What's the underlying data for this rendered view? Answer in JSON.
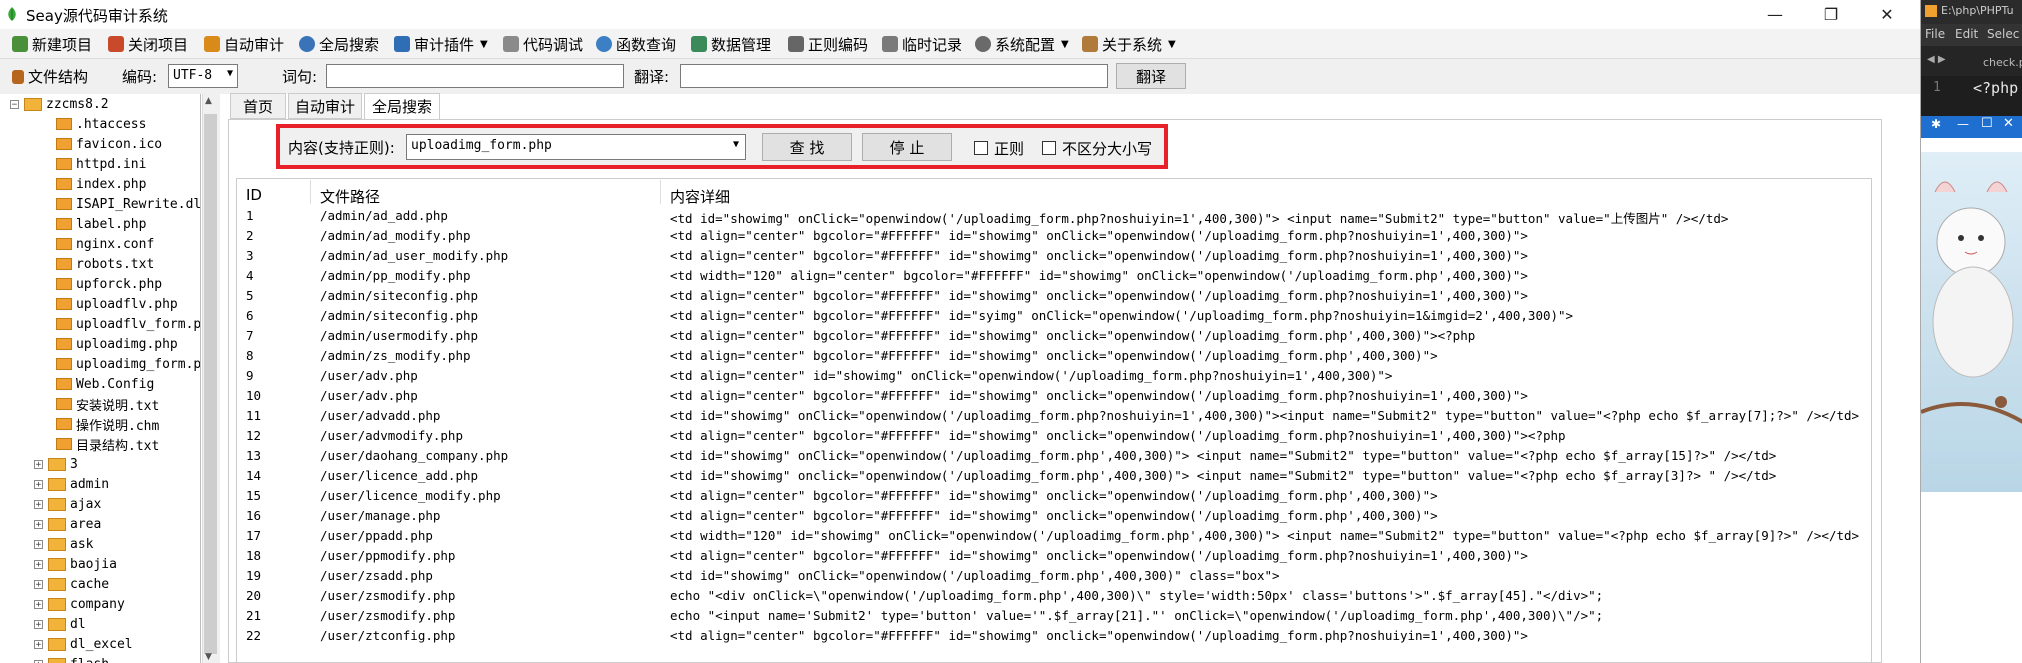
{
  "title": "Seay源代码审计系统",
  "toolbar": [
    {
      "label": "新建项目",
      "icon": "new-project-icon",
      "color": "#4a8f3a"
    },
    {
      "label": "关闭项目",
      "icon": "close-project-icon",
      "color": "#c84a2a"
    },
    {
      "label": "自动审计",
      "icon": "auto-audit-icon",
      "color": "#d98b1a"
    },
    {
      "label": "全局搜索",
      "icon": "global-search-icon",
      "color": "#3a73b8"
    },
    {
      "label": "审计插件",
      "icon": "plugin-icon",
      "color": "#2f6db5"
    },
    {
      "label": "代码调试",
      "icon": "debug-icon",
      "color": "#8a8a8a"
    },
    {
      "label": "函数查询",
      "icon": "function-search-icon",
      "color": "#3d7fc4"
    },
    {
      "label": "数据管理",
      "icon": "data-manage-icon",
      "color": "#3a8a5a"
    },
    {
      "label": "正则编码",
      "icon": "regex-encode-icon",
      "color": "#666666"
    },
    {
      "label": "临时记录",
      "icon": "temp-record-icon",
      "color": "#7a7a7a"
    },
    {
      "label": "系统配置",
      "icon": "settings-icon",
      "color": "#6a6a6a"
    },
    {
      "label": "关于系统",
      "icon": "about-icon",
      "color": "#b07a3a"
    }
  ],
  "toolbar2": {
    "structure_label": "文件结构",
    "encoding_label": "编码:",
    "encoding_value": "UTF-8",
    "term_label": "词句:",
    "term_value": "",
    "translate_label": "翻译:",
    "translate_value": "",
    "translate_button": "翻译"
  },
  "tree": {
    "root": "zzcms8.2",
    "files": [
      ".htaccess",
      "favicon.ico",
      "httpd.ini",
      "index.php",
      "ISAPI_Rewrite.dl",
      "label.php",
      "nginx.conf",
      "robots.txt",
      "upforck.php",
      "uploadflv.php",
      "uploadflv_form.p",
      "uploadimg.php",
      "uploadimg_form.p",
      "Web.Config",
      "安装说明.txt",
      "操作说明.chm",
      "目录结构.txt"
    ],
    "folders": [
      "3",
      "admin",
      "ajax",
      "area",
      "ask",
      "baojia",
      "cache",
      "company",
      "dl",
      "dl_excel",
      "flash"
    ]
  },
  "tabs": [
    "首页",
    "自动审计",
    "全局搜索"
  ],
  "search": {
    "content_label": "内容(支持正则):",
    "query": "uploadimg_form.php",
    "find_button": "查 找",
    "stop_button": "停 止",
    "regex_label": "正则",
    "case_label": "不区分大小写"
  },
  "results": {
    "headers": [
      "ID",
      "文件路径",
      "内容详细"
    ],
    "rows": [
      {
        "id": "1",
        "path": "/admin/ad_add.php",
        "detail": "<td id=\"showimg\" onClick=\"openwindow('/uploadimg_form.php?noshuiyin=1',400,300)\"> <input name=\"Submit2\" type=\"button\"  value=\"上传图片\" /></td>"
      },
      {
        "id": "2",
        "path": "/admin/ad_modify.php",
        "detail": "<td align=\"center\" bgcolor=\"#FFFFFF\" id=\"showimg\" onClick=\"openwindow('/uploadimg_form.php?noshuiyin=1',400,300)\">"
      },
      {
        "id": "3",
        "path": "/admin/ad_user_modify.php",
        "detail": "<td align=\"center\" bgcolor=\"#FFFFFF\" id=\"showimg\" onclick=\"openwindow('/uploadimg_form.php?noshuiyin=1',400,300)\">"
      },
      {
        "id": "4",
        "path": "/admin/pp_modify.php",
        "detail": "<td width=\"120\" align=\"center\" bgcolor=\"#FFFFFF\" id=\"showimg\" onClick=\"openwindow('/uploadimg_form.php',400,300)\">"
      },
      {
        "id": "5",
        "path": "/admin/siteconfig.php",
        "detail": "<td align=\"center\" bgcolor=\"#FFFFFF\" id=\"showimg\" onclick=\"openwindow('/uploadimg_form.php?noshuiyin=1',400,300)\">"
      },
      {
        "id": "6",
        "path": "/admin/siteconfig.php",
        "detail": "<td align=\"center\" bgcolor=\"#FFFFFF\" id=\"syimg\" onClick=\"openwindow('/uploadimg_form.php?noshuiyin=1&imgid=2',400,300)\">"
      },
      {
        "id": "7",
        "path": "/admin/usermodify.php",
        "detail": "<td align=\"center\" bgcolor=\"#FFFFFF\" id=\"showimg\" onclick=\"openwindow('/uploadimg_form.php',400,300)\"><?php"
      },
      {
        "id": "8",
        "path": "/admin/zs_modify.php",
        "detail": "<td align=\"center\" bgcolor=\"#FFFFFF\" id=\"showimg\" onclick=\"openwindow('/uploadimg_form.php',400,300)\">"
      },
      {
        "id": "9",
        "path": "/user/adv.php",
        "detail": "<td align=\"center\" id=\"showimg\" onClick=\"openwindow('/uploadimg_form.php?noshuiyin=1',400,300)\">"
      },
      {
        "id": "10",
        "path": "/user/adv.php",
        "detail": "<td align=\"center\" bgcolor=\"#FFFFFF\" id=\"showimg\" onclick=\"openwindow('/uploadimg_form.php?noshuiyin=1',400,300)\">"
      },
      {
        "id": "11",
        "path": "/user/advadd.php",
        "detail": "<td id=\"showimg\" onClick=\"openwindow('/uploadimg_form.php?noshuiyin=1',400,300)\"><input name=\"Submit2\" type=\"button\"  value=\"<?php echo $f_array[7];?>\" /></td>"
      },
      {
        "id": "12",
        "path": "/user/advmodify.php",
        "detail": "<td align=\"center\" bgcolor=\"#FFFFFF\" id=\"showimg\" onclick=\"openwindow('/uploadimg_form.php?noshuiyin=1',400,300)\"><?php"
      },
      {
        "id": "13",
        "path": "/user/daohang_company.php",
        "detail": "<td id=\"showimg\" onClick=\"openwindow('/uploadimg_form.php',400,300)\"> <input name=\"Submit2\" type=\"button\"  value=\"<?php echo $f_array[15]?>\" /></td>"
      },
      {
        "id": "14",
        "path": "/user/licence_add.php",
        "detail": "<td id=\"showimg\" onclick=\"openwindow('/uploadimg_form.php',400,300)\"> <input name=\"Submit2\" type=\"button\"  value=\"<?php echo $f_array[3]?> \" /></td>"
      },
      {
        "id": "15",
        "path": "/user/licence_modify.php",
        "detail": "<td align=\"center\" bgcolor=\"#FFFFFF\" id=\"showimg\" onclick=\"openwindow('/uploadimg_form.php',400,300)\">"
      },
      {
        "id": "16",
        "path": "/user/manage.php",
        "detail": "<td align=\"center\" bgcolor=\"#FFFFFF\" id=\"showimg\" onclick=\"openwindow('/uploadimg_form.php',400,300)\">"
      },
      {
        "id": "17",
        "path": "/user/ppadd.php",
        "detail": "<td width=\"120\" id=\"showimg\" onClick=\"openwindow('/uploadimg_form.php',400,300)\"> <input name=\"Submit2\" type=\"button\"  value=\"<?php echo $f_array[9]?>\" /></td>"
      },
      {
        "id": "18",
        "path": "/user/ppmodify.php",
        "detail": "<td align=\"center\" bgcolor=\"#FFFFFF\" id=\"showimg\" onclick=\"openwindow('/uploadimg_form.php?noshuiyin=1',400,300)\">"
      },
      {
        "id": "19",
        "path": "/user/zsadd.php",
        "detail": "<td id=\"showimg\" onClick=\"openwindow('/uploadimg_form.php',400,300)\" class=\"box\">"
      },
      {
        "id": "20",
        "path": "/user/zsmodify.php",
        "detail": "echo \"<div onClick=\\\"openwindow('/uploadimg_form.php',400,300)\\\" style='width:50px' class='buttons'>\".$f_array[45].\"</div>\";"
      },
      {
        "id": "21",
        "path": "/user/zsmodify.php",
        "detail": "echo \"<input name='Submit2' type='button'  value='\".$f_array[21].\"' onClick=\\\"openwindow('/uploadimg_form.php',400,300)\\\"/>\";"
      },
      {
        "id": "22",
        "path": "/user/ztconfig.php",
        "detail": "<td align=\"center\" bgcolor=\"#FFFFFF\" id=\"showimg\" onclick=\"openwindow('/uploadimg_form.php?noshuiyin=1',400,300)\">"
      }
    ]
  },
  "right_app": {
    "path": "E:\\php\\PHPTu",
    "menu": [
      "File",
      "Edit",
      "Selec"
    ],
    "tab": "check.p",
    "line_number": "1",
    "code": "<?php"
  },
  "colors": {
    "highlight_border": "#e8202a",
    "accent": "#1f6fd0"
  }
}
